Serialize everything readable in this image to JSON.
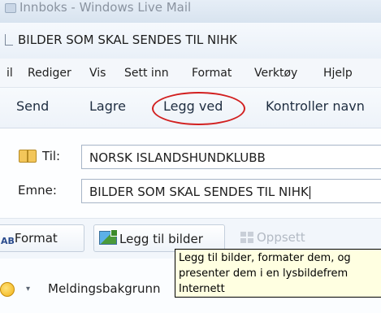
{
  "background_window": {
    "title": "Innboks - Windows Live Mail"
  },
  "window": {
    "title": "BILDER SOM SKAL SENDES TIL NIHK"
  },
  "menu": {
    "items": [
      "il",
      "Rediger",
      "Vis",
      "Sett inn",
      "Format",
      "Verktøy",
      "Hjelp"
    ]
  },
  "toolbar": {
    "send": "Send",
    "save": "Lagre",
    "attach": "Legg ved",
    "check_names": "Kontroller navn",
    "highlight_color": "#d22020"
  },
  "fields": {
    "to_label": "Til:",
    "to_value": "NORSK ISLANDSHUNDKLUBB",
    "subject_label": "Emne:",
    "subject_value": "BILDER SOM SKAL SENDES TIL NIHK"
  },
  "format_toolbar": {
    "format_icon": "AB",
    "format": "Format",
    "add_photos": "Legg til bilder",
    "layout": "Oppsett"
  },
  "tooltip": {
    "lines": [
      "Legg til bilder, formater dem, og",
      "presenter dem i en lysbildefrem",
      "Internett"
    ]
  },
  "bottom": {
    "dropdown_arrow": "▾",
    "background_label": "Meldingsbakgrunn"
  }
}
